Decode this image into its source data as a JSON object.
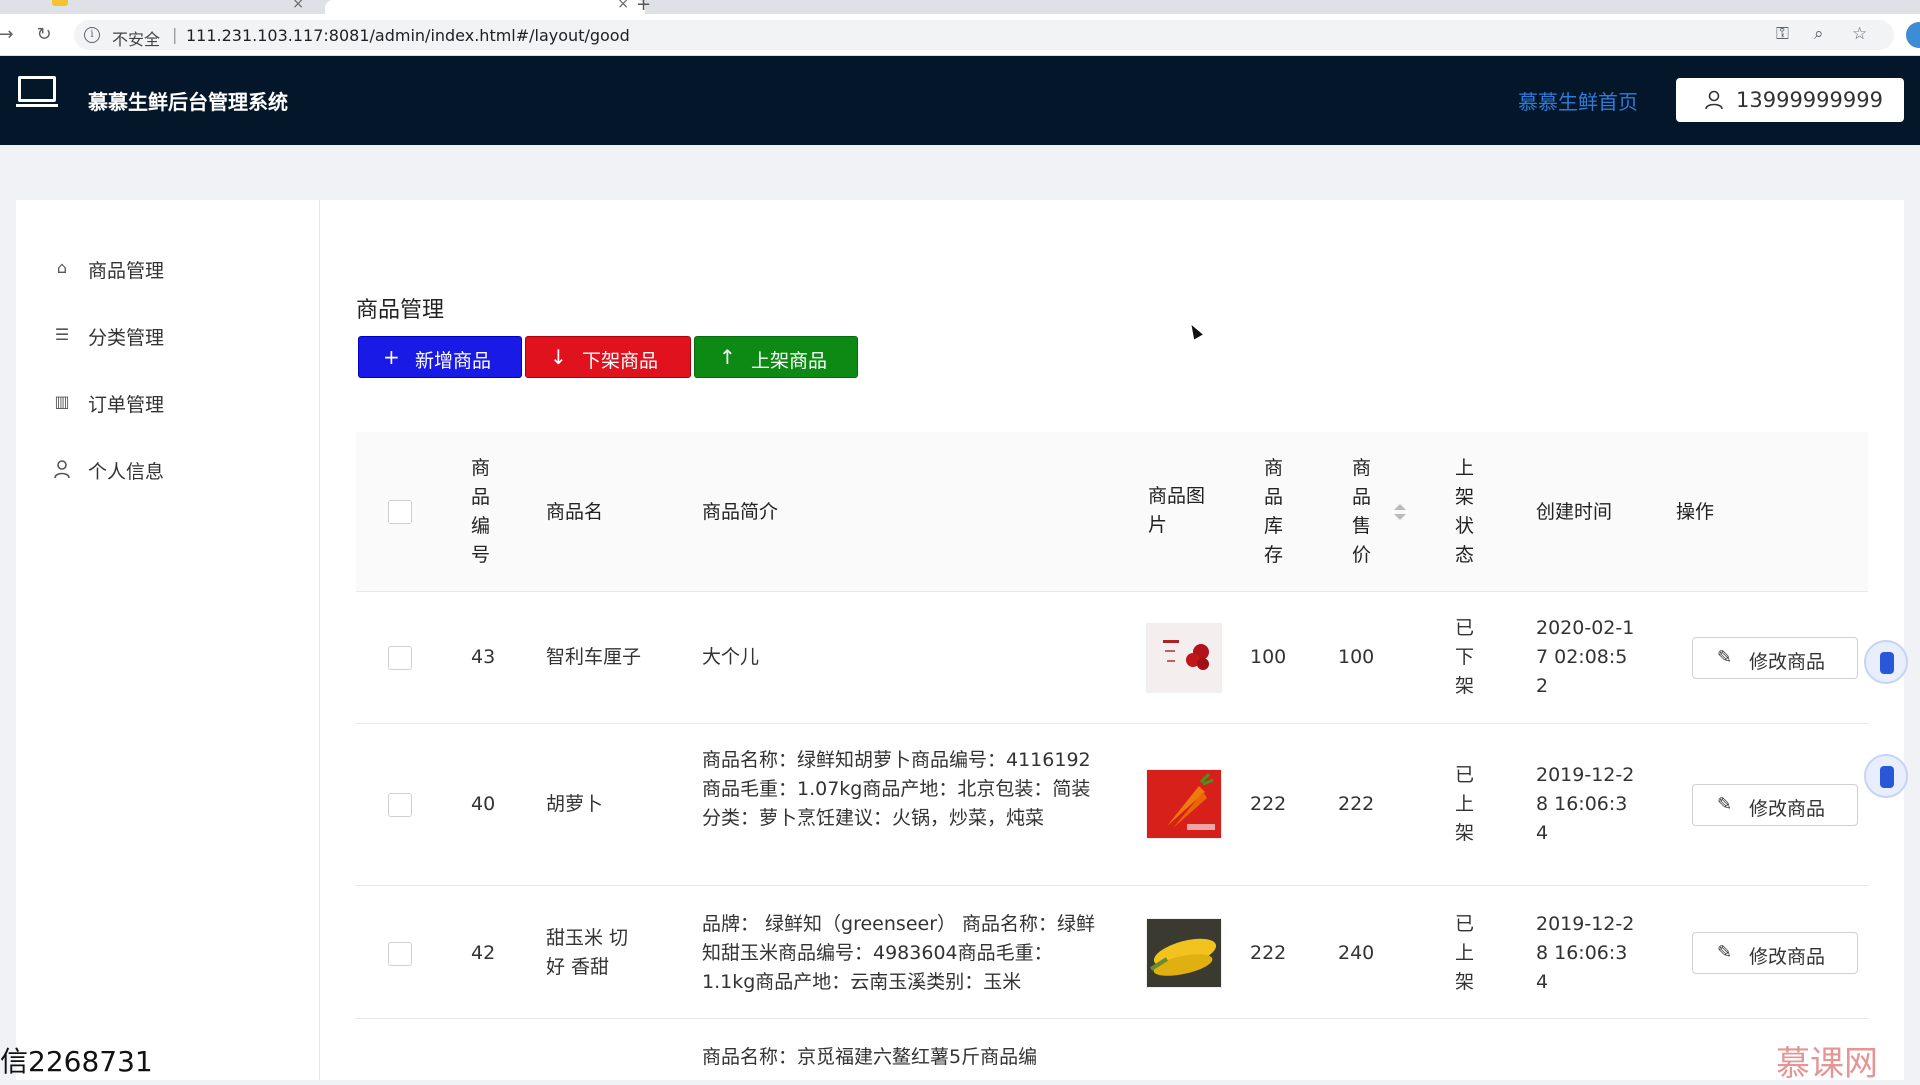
{
  "browser": {
    "security_label": "不安全",
    "separator": "|",
    "url": "111.231.103.117:8081/admin/index.html#/layout/good"
  },
  "header": {
    "title": "慕慕生鲜后台管理系统",
    "home_link": "慕慕生鲜首页",
    "username": "13999999999"
  },
  "sidebar": {
    "items": [
      {
        "label": "商品管理",
        "icon": "inbox-icon"
      },
      {
        "label": "分类管理",
        "icon": "list-icon"
      },
      {
        "label": "订单管理",
        "icon": "order-icon"
      },
      {
        "label": "个人信息",
        "icon": "user-icon"
      }
    ]
  },
  "main": {
    "title": "商品管理",
    "buttons": {
      "add": "新增商品",
      "offline": "下架商品",
      "online": "上架商品"
    },
    "table": {
      "headers": {
        "id": "商品编号",
        "name": "商品名",
        "desc": "商品简介",
        "image": "商品图片",
        "stock": "商品库存",
        "price": "商品售价",
        "status": "上架状态",
        "created": "创建时间",
        "action": "操作"
      },
      "rows": [
        {
          "id": "43",
          "name": "智利车厘子",
          "desc": "大个儿",
          "stock": "100",
          "price": "100",
          "status": "已下架",
          "created": "2020-02-17 02:08:52",
          "edit": "修改商品"
        },
        {
          "id": "40",
          "name": "胡萝卜",
          "desc": "商品名称：绿鲜知胡萝卜商品编号：4116192商品毛重：1.07kg商品产地：北京包装：简装分类：萝卜烹饪建议：火锅，炒菜，炖菜",
          "stock": "222",
          "price": "222",
          "status": "已上架",
          "created": "2019-12-28 16:06:34",
          "edit": "修改商品"
        },
        {
          "id": "42",
          "name": "甜玉米 切好 香甜",
          "desc": "品牌： 绿鲜知（greenseer） 商品名称：绿鲜知甜玉米商品编号：4983604商品毛重：1.1kg商品产地：云南玉溪类别：玉米",
          "stock": "222",
          "price": "240",
          "status": "已上架",
          "created": "2019-12-28 16:06:34",
          "edit": "修改商品"
        },
        {
          "desc_partial": "商品名称：京觅福建六鳌红薯5斤商品编"
        }
      ]
    }
  },
  "overlay": {
    "watermark_left": "信2268731",
    "watermark_right": "慕课网"
  }
}
